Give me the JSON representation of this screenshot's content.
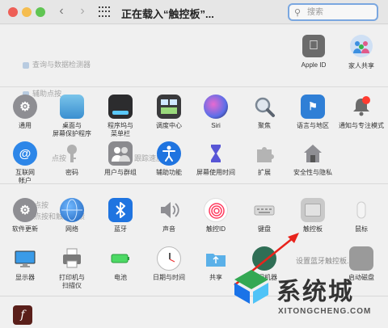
{
  "window": {
    "title": "正在载入“触控板”...",
    "nav_back": "‹",
    "nav_forward": "›"
  },
  "search": {
    "placeholder": "搜索",
    "icon": "magnifier-icon"
  },
  "account": [
    {
      "label": "Apple ID",
      "icon": "apple-icon"
    },
    {
      "label": "家人共享",
      "icon": "family-icon"
    }
  ],
  "ghost_text": {
    "line1": "查询与数据检测器",
    "line2": "辅助点按",
    "line3": "点按",
    "line4": "跟踪速度",
    "line5": "静默点按",
    "line6": "用力点按和触觉反馈",
    "line7": "设置蓝牙触控板..."
  },
  "rows": [
    [
      {
        "label": "通用",
        "icon": "general-icon"
      },
      {
        "label": "桌面与\n屏幕保护程序",
        "icon": "desktop-icon"
      },
      {
        "label": "程序坞与\n菜单栏",
        "icon": "dock-icon"
      },
      {
        "label": "调度中心",
        "icon": "mission-control-icon"
      },
      {
        "label": "Siri",
        "icon": "siri-icon"
      },
      {
        "label": "聚焦",
        "icon": "spotlight-icon"
      },
      {
        "label": "语言与地区",
        "icon": "language-icon"
      },
      {
        "label": "通知与专注模式",
        "icon": "notification-icon"
      }
    ],
    [
      {
        "label": "互联网\n帐户",
        "icon": "internet-accounts-icon"
      },
      {
        "label": "密码",
        "icon": "key-icon"
      },
      {
        "label": "用户与群组",
        "icon": "users-icon"
      },
      {
        "label": "辅助功能",
        "icon": "accessibility-icon"
      },
      {
        "label": "屏幕使用时间",
        "icon": "screen-time-icon"
      },
      {
        "label": "扩展",
        "icon": "extensions-icon"
      },
      {
        "label": "安全性与隐私",
        "icon": "security-icon"
      }
    ],
    [
      {
        "label": "软件更新",
        "icon": "software-update-icon"
      },
      {
        "label": "网络",
        "icon": "network-icon"
      },
      {
        "label": "蓝牙",
        "icon": "bluetooth-icon"
      },
      {
        "label": "声音",
        "icon": "sound-icon"
      },
      {
        "label": "触控ID",
        "icon": "touch-id-icon"
      },
      {
        "label": "键盘",
        "icon": "keyboard-icon"
      },
      {
        "label": "触控板",
        "icon": "trackpad-icon"
      },
      {
        "label": "鼠标",
        "icon": "mouse-icon"
      }
    ],
    [
      {
        "label": "显示器",
        "icon": "display-icon"
      },
      {
        "label": "打印机与\n扫描仪",
        "icon": "printer-icon"
      },
      {
        "label": "电池",
        "icon": "battery-icon"
      },
      {
        "label": "日期与时间",
        "icon": "clock-icon"
      },
      {
        "label": "共享",
        "icon": "sharing-icon"
      },
      {
        "label": "时间机器",
        "icon": "time-machine-icon"
      },
      {
        "label": "启动磁盘",
        "icon": "startup-disk-icon"
      }
    ]
  ],
  "watermark": {
    "text": "系统城",
    "url": "XITONGCHENG.COM"
  },
  "bottom": {
    "icon": "flash-icon",
    "glyph": "f"
  }
}
